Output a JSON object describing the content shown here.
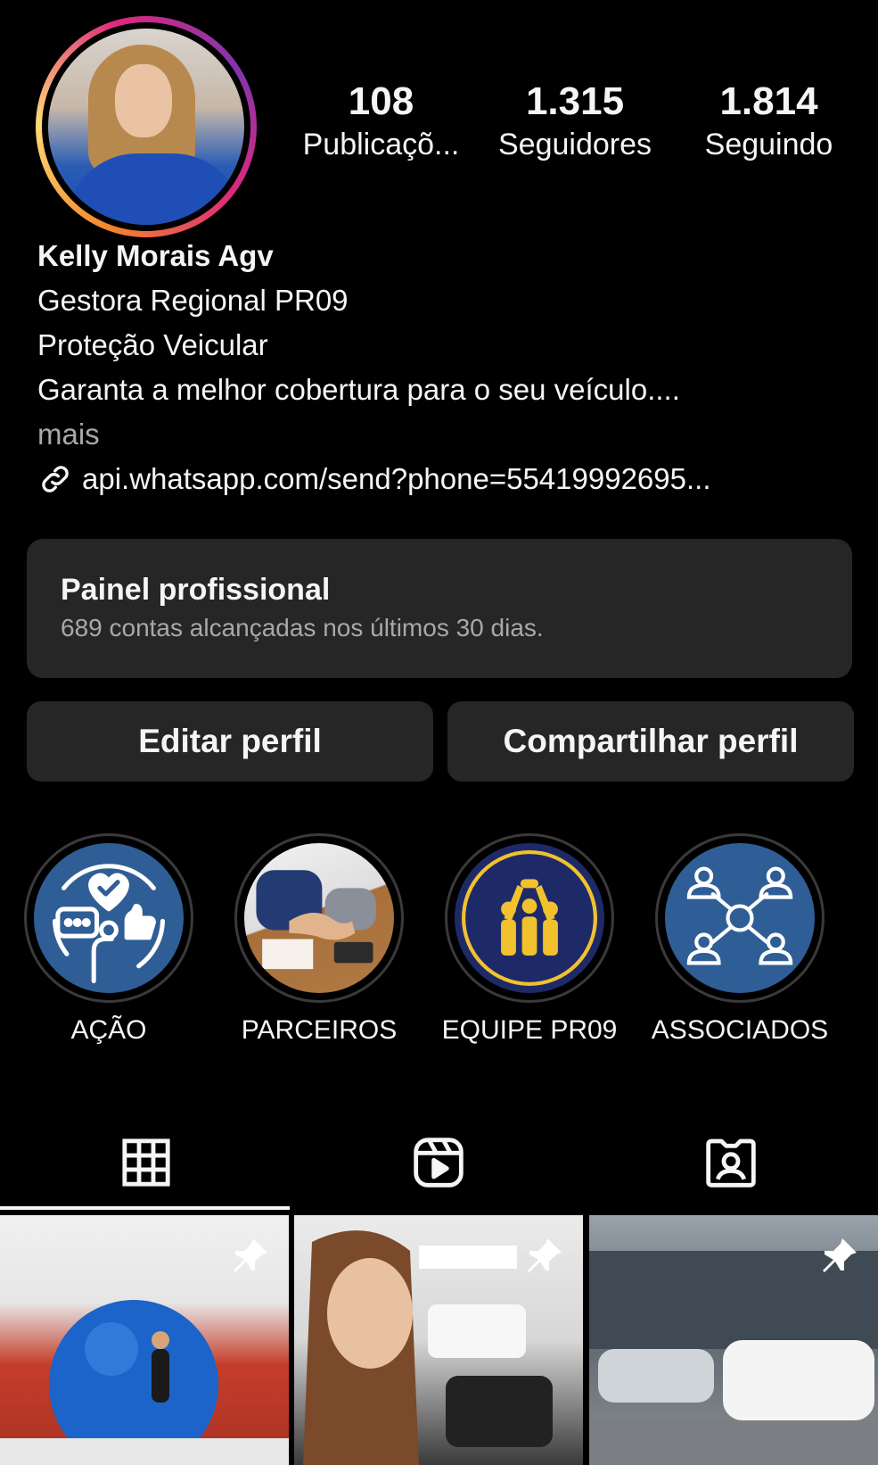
{
  "profile": {
    "avatar_alt": "Kelly Morais Agv",
    "stats": [
      {
        "value": "108",
        "label": "Publicaçõ..."
      },
      {
        "value": "1.315",
        "label": "Seguidores"
      },
      {
        "value": "1.814",
        "label": "Seguindo"
      }
    ],
    "name": "Kelly Morais Agv",
    "bio_lines": [
      "Gestora Regional PR09",
      "Proteção Veicular",
      "Garanta a melhor cobertura para o seu veículo...."
    ],
    "more_label": "mais",
    "link": "api.whatsapp.com/send?phone=55419992695..."
  },
  "dashboard": {
    "title": "Painel profissional",
    "subtitle": "689 contas alcançadas nos últimos 30 dias."
  },
  "actions": {
    "edit_label": "Editar perfil",
    "share_label": "Compartilhar perfil"
  },
  "highlights": [
    {
      "label": "AÇÃO",
      "icon": "feedback-icon"
    },
    {
      "label": "PARCEIROS",
      "icon": "handshake-photo"
    },
    {
      "label": "EQUIPE PR09",
      "icon": "team-icon"
    },
    {
      "label": "ASSOCIADOS",
      "icon": "network-icon"
    }
  ],
  "tabs": [
    {
      "name": "grid",
      "icon": "grid-icon",
      "active": true
    },
    {
      "name": "reels",
      "icon": "reels-icon",
      "active": false
    },
    {
      "name": "tagged",
      "icon": "tagged-icon",
      "active": false
    }
  ],
  "posts": [
    {
      "pinned": true,
      "icon": "pin-icon"
    },
    {
      "pinned": true,
      "icon": "pin-icon"
    },
    {
      "pinned": true,
      "icon": "pin-icon"
    }
  ],
  "colors": {
    "background": "#000000",
    "surface": "#262626",
    "muted_text": "#a8a8a8",
    "highlight_blue": "#2f5e96",
    "team_navy": "#1e2a68",
    "team_gold": "#f2c12e"
  }
}
